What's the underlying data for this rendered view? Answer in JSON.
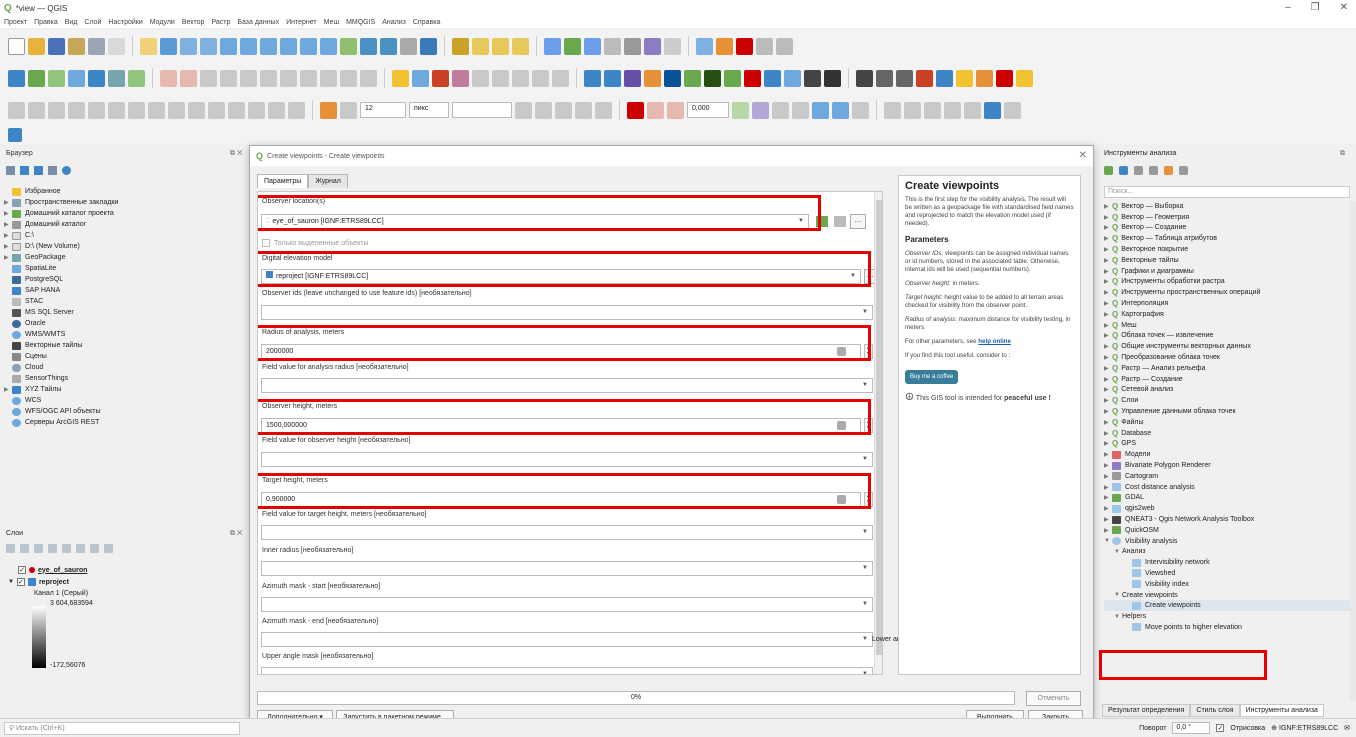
{
  "window": {
    "title": "*view — QGIS",
    "controls": [
      "–",
      "❐",
      "✕"
    ]
  },
  "menu": [
    "Проект",
    "Правка",
    "Вид",
    "Слой",
    "Настройки",
    "Модули",
    "Вектор",
    "Растр",
    "База данных",
    "Интернет",
    "Меш",
    "MMQGIS",
    "Анализ",
    "Справка"
  ],
  "toolbar": {
    "font_size": "12",
    "unit": "пикс",
    "rotation_field": "0,000"
  },
  "browser": {
    "title": "Браузер",
    "items": [
      "Избранное",
      "Пространственные закладки",
      "Домашний каталог проекта",
      "Домашний каталог",
      "C:\\",
      "D:\\ (New Volume)",
      "GeoPackage",
      "SpatiaLite",
      "PostgreSQL",
      "SAP HANA",
      "STAC",
      "MS SQL Server",
      "Oracle",
      "WMS/WMTS",
      "Векторные тайлы",
      "Сцены",
      "Cloud",
      "SensorThings",
      "XYZ Тайлы",
      "WCS",
      "WFS/OGC API объекты",
      "Серверы ArcGIS REST"
    ]
  },
  "layers": {
    "title": "Слои",
    "layer1": "eye_of_sauron",
    "layer2": "reproject",
    "band": "Канал 1 (Серый)",
    "max": "3 604,683594",
    "min": "-172,56076"
  },
  "dialog": {
    "title": "Create viewpoints - Create viewpoints",
    "tabs": [
      "Параметры",
      "Журнал"
    ],
    "observer_location_label": "Observer location(s)",
    "observer_location_value": "eye_of_sauron [IGNF:ETRS89LCC]",
    "only_selected": "Только выделенные объекты",
    "dem_label": "Digital elevation model",
    "dem_value": "reproject [IGNF:ETRS89LCC]",
    "observer_ids_label": "Observer ids (leave unchanged to use feature ids) [необязательно]",
    "radius_label": "Radius of analysis, meters",
    "radius_value": "2000000",
    "field_radius_label": "Field value for analysis radius [необязательно]",
    "height_label": "Observer height, meters",
    "height_value": "1500,000000",
    "field_height_label": "Field value for observer height [необязательно]",
    "target_label": "Target height, meters",
    "target_value": "0,900000",
    "field_target_label": "Field value for target height, meters [необязательно]",
    "inner_radius_label": "Inner radius [необязательно]",
    "az_start_label": "Azimuth mask - start [необязательно]",
    "az_end_label": "Azimuth mask - end [необязательно]",
    "upper_label": "Upper angle mask [необязательно]",
    "lower_label": "Lower angle mask [необязательно]",
    "progress": "0%",
    "cancel": "Отменить",
    "advanced": "Дополнительно ▾",
    "batch": "Запустить в пакетном режиме...",
    "run": "Выполнить",
    "close": "Закрыть"
  },
  "help": {
    "title": "Create viewpoints",
    "p1": "This is the first step for the visibility analysis. The result will be written as a geopackage file with standardised field names and reprojected to match the elevation model used (if needed).",
    "params_title": "Parameters",
    "p2_em": "Observer IDs",
    "p2": ": viewpoints can be assigned individual names or id numbers, stored in the associated table. Otherwise, internal ids will be used (sequential numbers).",
    "p3_em": "Observer height",
    "p3": ": in meters.",
    "p4_em": "Target height",
    "p4": ": height value to be added to all terrain areas checked for visibility from the observer point.",
    "p5_em": "Radius of analysis",
    "p5": ": maximum distance for visibility testing, in meters.",
    "p6": "For other parameters, see ",
    "p6_link": "help online",
    "p7": "If you find this tool useful, consider to :",
    "coffee": "Buy me a coffee",
    "p8": "This GIS tool is intended for ",
    "p8_b": "peaceful use !"
  },
  "toolbox": {
    "title": "Инструменты анализа",
    "search": "Поиск...",
    "items": [
      "Вектор — Выборка",
      "Вектор — Геометрия",
      "Вектор — Создание",
      "Вектор — Таблица атрибутов",
      "Векторное покрытие",
      "Векторные тайлы",
      "Графики и диаграммы",
      "Инструменты обработки растра",
      "Инструменты пространственных операций",
      "Интерполяция",
      "Картография",
      "Меш",
      "Облака точек — извлечение",
      "Общие инструменты векторных данных",
      "Преобразование облака точек",
      "Растр — Анализ рельефа",
      "Растр — Создание",
      "Сетевой анализ",
      "Слои",
      "Управление данными облака точек",
      "Файлы",
      "Database",
      "GPS",
      "Модели",
      "Bivariate Polygon Renderer",
      "Cartogram",
      "Cost distance analysis",
      "GDAL",
      "qgis2web",
      "QNEAT3 - Qgis Network Analysis Toolbox",
      "QuickOSM",
      "Visibility analysis"
    ],
    "sub_analysis": "Анализ",
    "sub_items": [
      "Intervisibility network",
      "Viewshed",
      "Visibility index"
    ],
    "create_group": "Create viewpoints",
    "create_item": "Create viewpoints",
    "helpers_group": "Helpers",
    "move_item": "Move points to higher elevation",
    "bottom_tabs": [
      "Результат определения",
      "Стиль слоя",
      "Инструменты анализа"
    ]
  },
  "status": {
    "search_placeholder": "Искать (Ctrl+K)",
    "rotation_label": "Поворот",
    "rotation_value": "0,0 °",
    "render": "Отрисовка",
    "crs": "IGNF:ETRS89LCC"
  }
}
